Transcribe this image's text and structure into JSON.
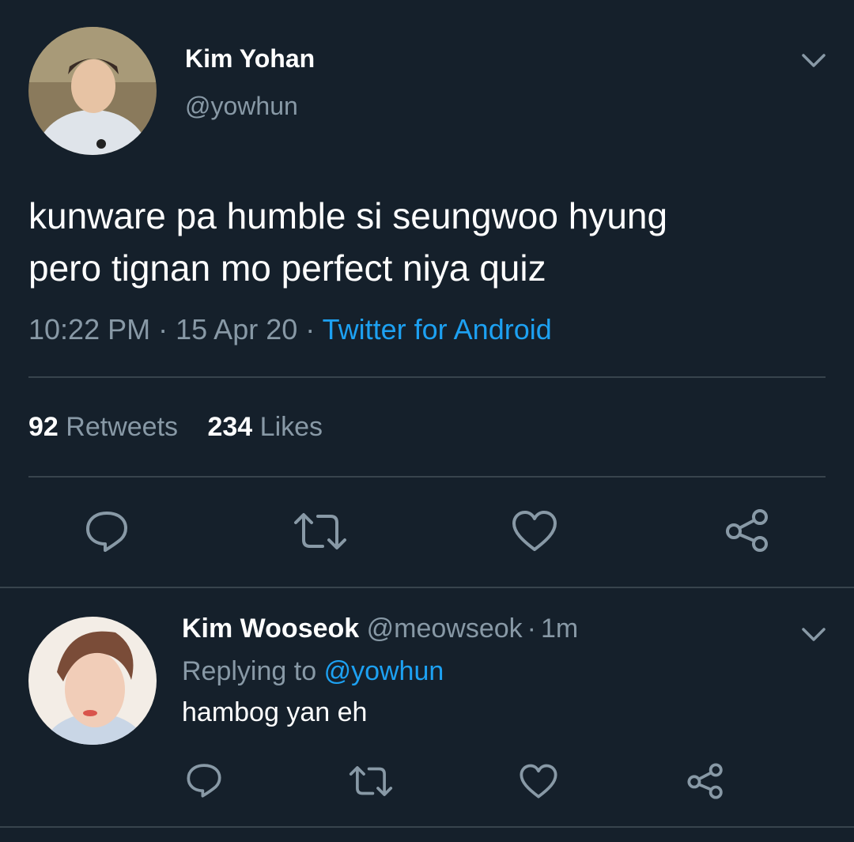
{
  "main_tweet": {
    "author_name": "Kim Yohan",
    "author_handle": "@yowhun",
    "text_line1": "kunware pa humble si seungwoo hyung",
    "text_line2": "pero tignan mo perfect niya quiz",
    "time": "10:22 PM",
    "date": "15 Apr 20",
    "source": "Twitter for Android",
    "sep": "·",
    "retweet_count": "92",
    "retweet_label": "Retweets",
    "like_count": "234",
    "like_label": "Likes"
  },
  "reply": {
    "author_name": "Kim Wooseok",
    "author_handle": "@meowseok",
    "sep": "·",
    "time_ago": "1m",
    "replying_label": "Replying to",
    "replying_handle": "@yowhun",
    "text": "hambog yan eh"
  },
  "icons": {
    "reply": "reply-icon",
    "retweet": "retweet-icon",
    "like": "heart-icon",
    "share": "share-icon",
    "menu": "chevron-down-icon"
  },
  "colors": {
    "background": "#15202b",
    "text": "#ffffff",
    "muted": "#8899a6",
    "link": "#1da1f2",
    "divider": "#38444d"
  }
}
